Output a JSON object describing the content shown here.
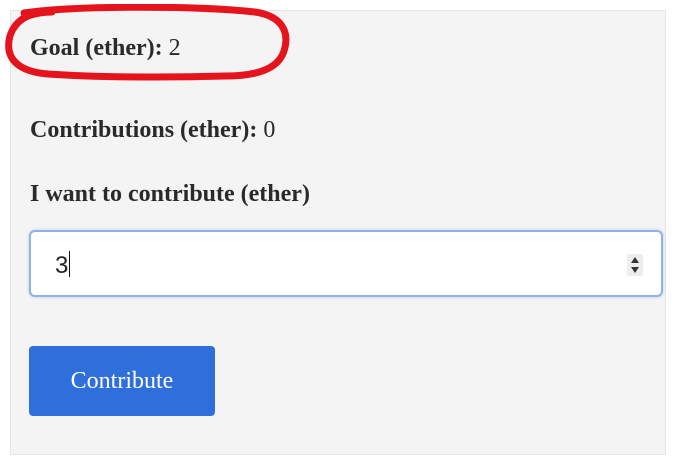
{
  "goal": {
    "label": "Goal (ether):",
    "value": "2"
  },
  "contributions": {
    "label": "Contributions (ether):",
    "value": "0"
  },
  "contribute_form": {
    "label": "I want to contribute (ether)",
    "input_value": "3",
    "button_label": "Contribute"
  },
  "colors": {
    "annotation": "#e5131c",
    "button": "#2f6fdc",
    "input_focus_border": "#8fb2e8",
    "panel_background": "#f4f4f4"
  },
  "icons": {
    "spinner": "spinner-arrows-icon"
  }
}
